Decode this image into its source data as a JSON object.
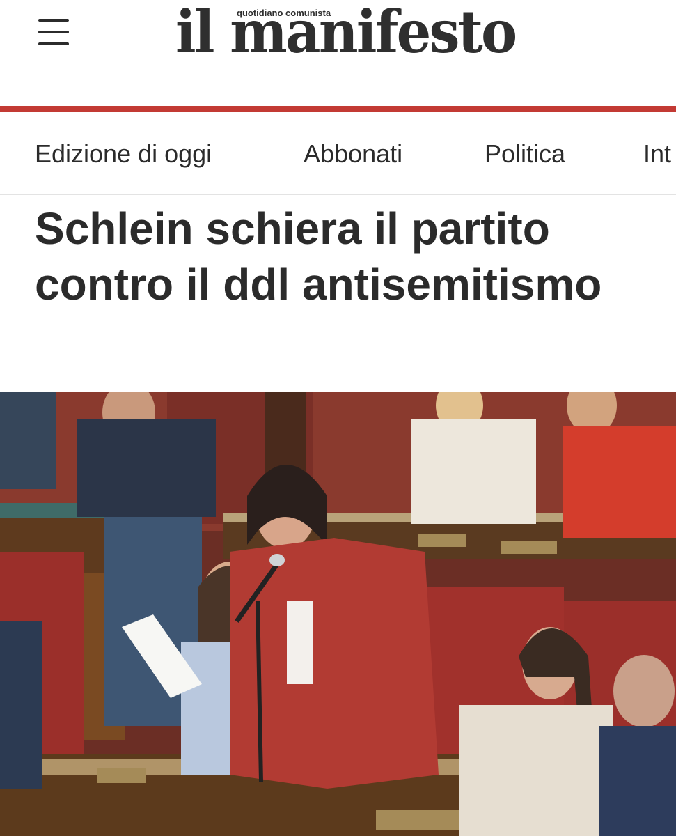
{
  "header": {
    "menu_icon": "hamburger-menu-icon",
    "logo_text": "il manifesto",
    "logo_tagline": "quotidiano comunista",
    "accent_color": "#c33a34"
  },
  "nav": {
    "items": [
      {
        "label": "Edizione di oggi"
      },
      {
        "label": "Abbonati"
      },
      {
        "label": "Politica"
      },
      {
        "label": "Int"
      }
    ]
  },
  "article": {
    "headline": "Schlein schiera il partito contro il ddl antisemitismo"
  }
}
